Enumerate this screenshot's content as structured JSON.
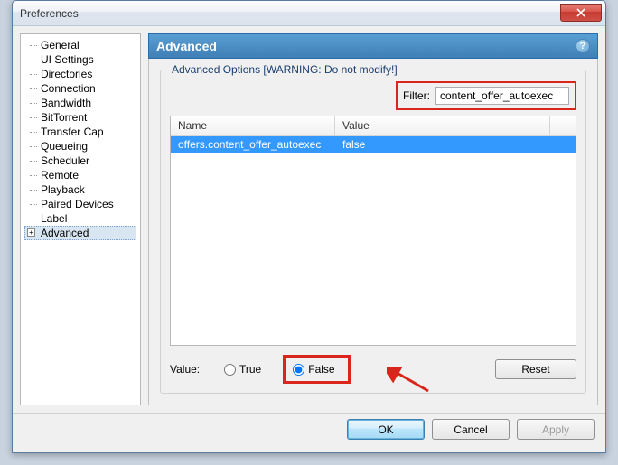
{
  "window": {
    "title": "Preferences"
  },
  "sidebar": {
    "items": [
      {
        "label": "General"
      },
      {
        "label": "UI Settings"
      },
      {
        "label": "Directories"
      },
      {
        "label": "Connection"
      },
      {
        "label": "Bandwidth"
      },
      {
        "label": "BitTorrent"
      },
      {
        "label": "Transfer Cap"
      },
      {
        "label": "Queueing"
      },
      {
        "label": "Scheduler"
      },
      {
        "label": "Remote"
      },
      {
        "label": "Playback"
      },
      {
        "label": "Paired Devices"
      },
      {
        "label": "Label"
      },
      {
        "label": "Advanced",
        "selected": true,
        "expandable": true
      }
    ]
  },
  "main": {
    "header": "Advanced",
    "group_label": "Advanced Options [WARNING: Do not modify!]",
    "filter_label": "Filter:",
    "filter_value": "content_offer_autoexec",
    "columns": {
      "name": "Name",
      "value": "Value"
    },
    "rows": [
      {
        "name": "offers.content_offer_autoexec",
        "value": "false",
        "selected": true
      }
    ],
    "value_label": "Value:",
    "radio_true": "True",
    "radio_false": "False",
    "reset_label": "Reset",
    "help_glyph": "?"
  },
  "buttons": {
    "ok": "OK",
    "cancel": "Cancel",
    "apply": "Apply"
  }
}
